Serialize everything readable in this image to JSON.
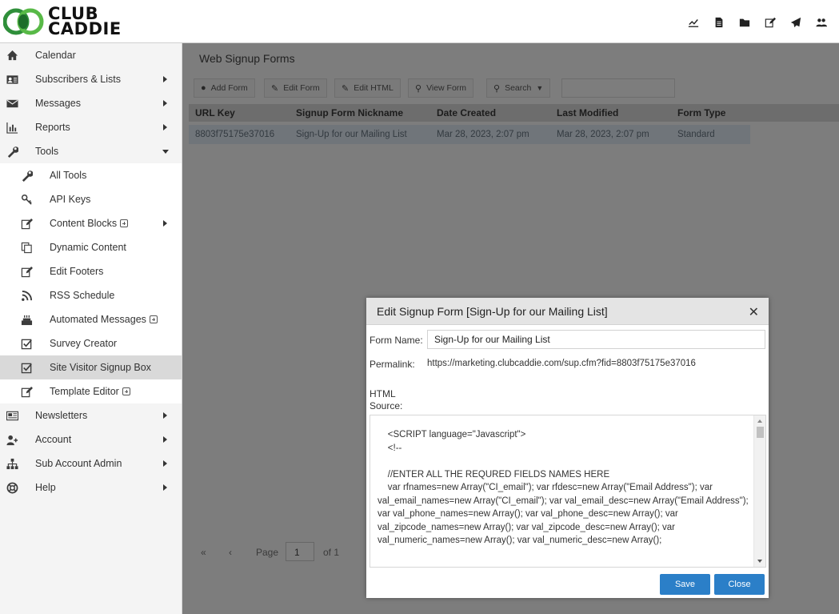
{
  "brand": {
    "line1": "CLUB",
    "line2": "CADDIE"
  },
  "top_icons": [
    "chart-line-icon",
    "file-icon",
    "folder-icon",
    "edit-icon",
    "paper-plane-icon",
    "users-icon"
  ],
  "sidebar": {
    "items": [
      {
        "label": "Calendar",
        "icon": "home-icon"
      },
      {
        "label": "Subscribers & Lists",
        "icon": "address-card-icon"
      },
      {
        "label": "Messages",
        "icon": "envelope-icon"
      },
      {
        "label": "Reports",
        "icon": "bar-chart-icon"
      },
      {
        "label": "Tools",
        "icon": "wrench-icon"
      }
    ],
    "tools_sub": [
      {
        "label": "All Tools",
        "icon": "wrench-icon"
      },
      {
        "label": "API Keys",
        "icon": "key-icon"
      },
      {
        "label": "Content Blocks",
        "icon": "edit-icon"
      },
      {
        "label": "Dynamic Content",
        "icon": "copy-icon"
      },
      {
        "label": "Edit Footers",
        "icon": "edit-icon"
      },
      {
        "label": "RSS Schedule",
        "icon": "rss-icon"
      },
      {
        "label": "Automated Messages",
        "icon": "cake-icon"
      },
      {
        "label": "Survey Creator",
        "icon": "check-square-icon"
      },
      {
        "label": "Site Visitor Signup Box",
        "icon": "check-square-icon"
      },
      {
        "label": "Template Editor",
        "icon": "edit-icon"
      }
    ],
    "items_after": [
      {
        "label": "Newsletters",
        "icon": "newspaper-icon"
      },
      {
        "label": "Account",
        "icon": "user-plus-icon"
      },
      {
        "label": "Sub Account Admin",
        "icon": "sitemap-icon"
      },
      {
        "label": "Help",
        "icon": "life-ring-icon"
      }
    ]
  },
  "main": {
    "title": "Web Signup Forms",
    "toolbar": {
      "add_form": "Add Form",
      "edit_form": "Edit Form",
      "edit_html": "Edit HTML",
      "view_form": "View Form",
      "search": "Search"
    },
    "grid": {
      "columns": [
        "URL Key",
        "Signup Form Nickname",
        "Date Created",
        "Last Modified",
        "Form Type"
      ],
      "rows": [
        [
          "8803f75175e37016",
          "Sign-Up for our Mailing List",
          "Mar 28, 2023, 2:07 pm",
          "Mar 28, 2023, 2:07 pm",
          "Standard"
        ]
      ]
    },
    "pager": {
      "page_label": "Page",
      "page_value": "1",
      "of_label": "of 1"
    }
  },
  "modal": {
    "title": "Edit Signup Form [Sign-Up for our Mailing List]",
    "form_name_label": "Form Name:",
    "form_name_value": "Sign-Up for our Mailing List",
    "permalink_label": "Permalink:",
    "permalink_value": "https://marketing.clubcaddie.com/sup.cfm?fid=8803f75175e37016",
    "html_label_1": "HTML",
    "html_label_2": "Source:",
    "html_source": "    <SCRIPT language=\"Javascript\">\n    <!--\n\n    //ENTER ALL THE REQURED FIELDS NAMES HERE\n    var rfnames=new Array(\"CI_email\"); var rfdesc=new Array(\"Email Address\"); var val_email_names=new Array(\"CI_email\"); var val_email_desc=new Array(\"Email Address\"); var val_phone_names=new Array(); var val_phone_desc=new Array(); var val_zipcode_names=new Array(); var val_zipcode_desc=new Array(); var val_numeric_names=new Array(); var val_numeric_desc=new Array();",
    "save_label": "Save",
    "close_label": "Close"
  },
  "colors": {
    "accent": "#2b7fc8",
    "overlay_bg": "#7d7d7d",
    "active_item": "#d9d9d9"
  }
}
